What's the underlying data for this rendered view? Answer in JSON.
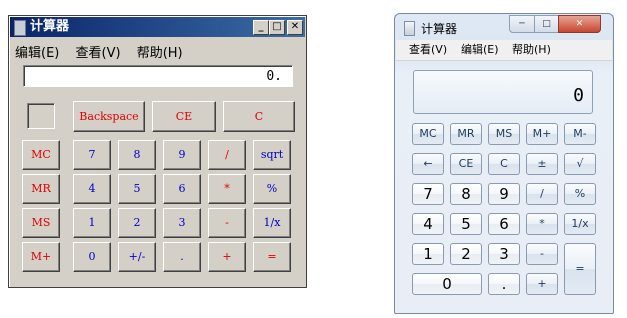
{
  "xp": {
    "title": "计算器",
    "window_controls": {
      "minimize": "_",
      "maximize": "□",
      "close": "✕"
    },
    "menu": [
      "编辑(E)",
      "查看(V)",
      "帮助(H)"
    ],
    "display": "0.",
    "top_buttons": [
      "Backspace",
      "CE",
      "C"
    ],
    "rows": [
      [
        "MC",
        "7",
        "8",
        "9",
        "/",
        "sqrt"
      ],
      [
        "MR",
        "4",
        "5",
        "6",
        "*",
        "%"
      ],
      [
        "MS",
        "1",
        "2",
        "3",
        "-",
        "1/x"
      ],
      [
        "M+",
        "0",
        "+/-",
        ".",
        "+",
        "="
      ]
    ],
    "text_colors": {
      "operator": "#e00000",
      "digit": "#0000c8"
    }
  },
  "win7": {
    "title": "计算器",
    "window_controls": {
      "minimize": "─",
      "maximize": "□",
      "close": "✕"
    },
    "menu": [
      "查看(V)",
      "编辑(E)",
      "帮助(H)"
    ],
    "display": "0",
    "memory_row": [
      "MC",
      "MR",
      "MS",
      "M+",
      "M-"
    ],
    "rows": [
      [
        "←",
        "CE",
        "C",
        "±",
        "√"
      ],
      [
        "7",
        "8",
        "9",
        "/",
        "%"
      ],
      [
        "4",
        "5",
        "6",
        "*",
        "1/x"
      ],
      [
        "1",
        "2",
        "3",
        "-",
        "="
      ],
      [
        "0",
        ".",
        "+"
      ]
    ]
  }
}
